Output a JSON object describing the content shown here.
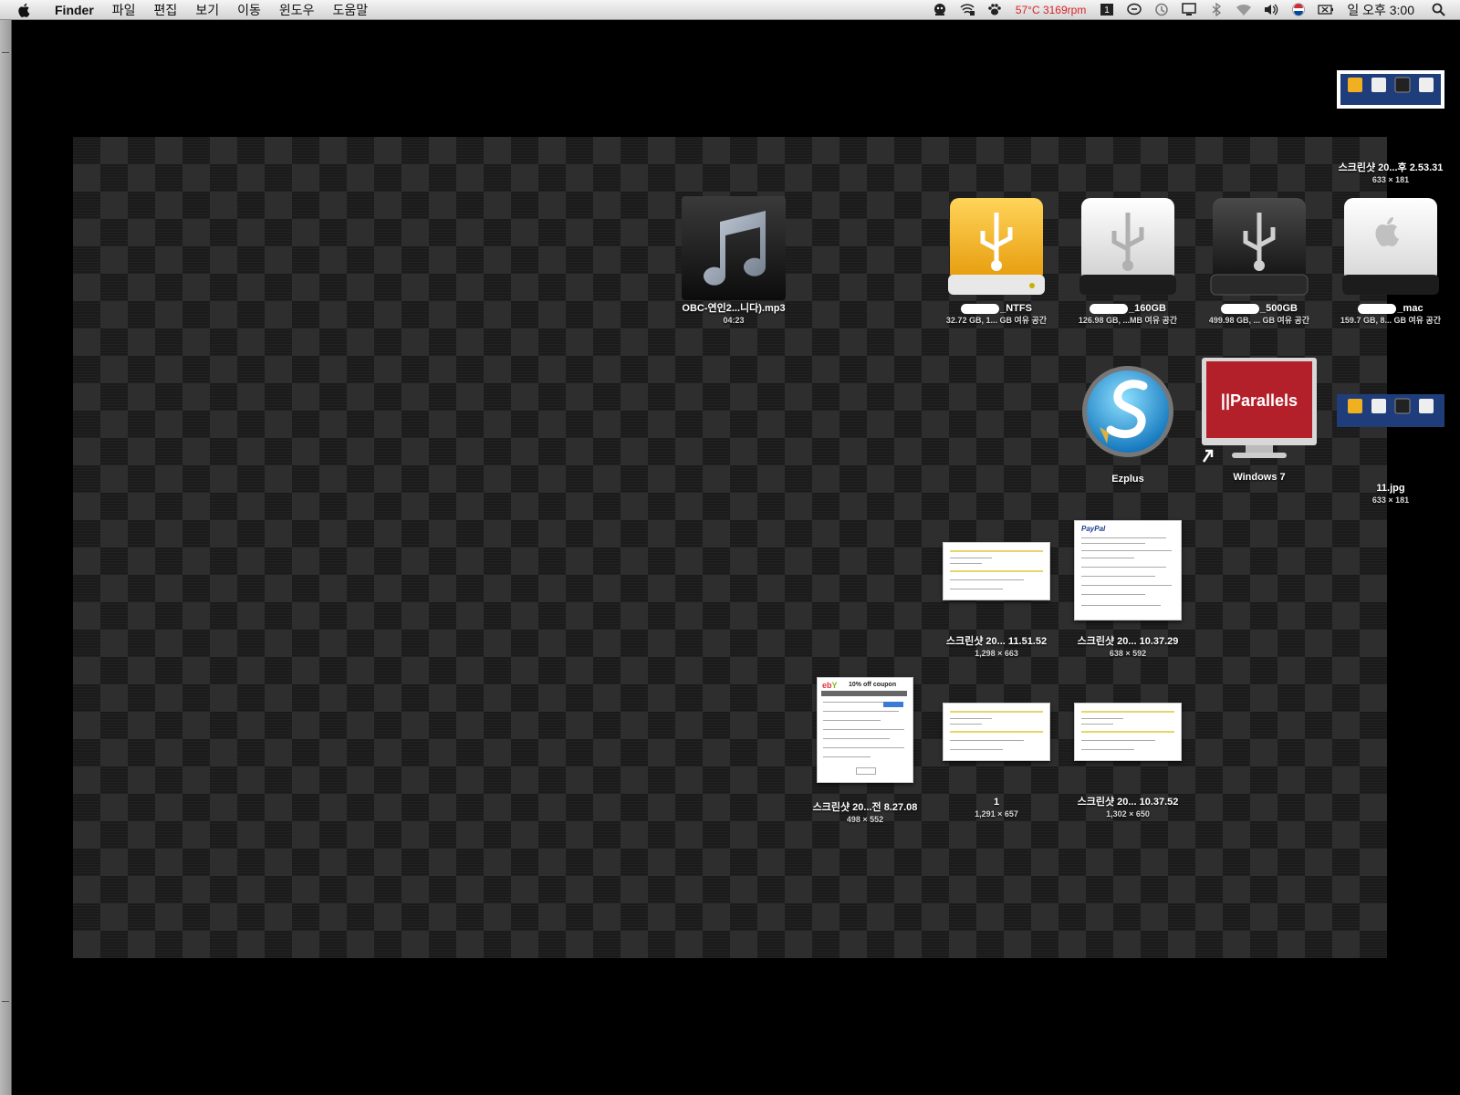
{
  "menubar": {
    "app_name": "Finder",
    "menus": [
      "파일",
      "편집",
      "보기",
      "이동",
      "윈도우",
      "도움말"
    ],
    "status_text": "57°C 3169rpm",
    "clock": "일 오후 3:00",
    "status_icons": [
      "monitor-face-icon",
      "wifi-settings-icon",
      "paw-icon",
      "temperature-icon",
      "spaces-icon",
      "chat-icon",
      "time-machine-icon",
      "display-icon",
      "bluetooth-icon",
      "wifi-icon",
      "volume-icon",
      "input-flag-icon",
      "battery-icon",
      "spotlight-icon"
    ],
    "status_color": "#d8232a"
  },
  "desktop": {
    "items": [
      {
        "id": "mp3",
        "name": "OBC-연인2...니다).mp3",
        "sub": "04:23",
        "icon": "music-note-icon"
      },
      {
        "id": "ntfs",
        "name": "_NTFS",
        "sub": "32.72 GB, 1... GB 여유 공간",
        "icon": "usb-drive-yellow-icon",
        "redacted": true
      },
      {
        "id": "160",
        "name": "_160GB",
        "sub": "126.98 GB, ...MB 여유 공간",
        "icon": "usb-drive-white-icon",
        "redacted": true
      },
      {
        "id": "500",
        "name": "_500GB",
        "sub": "499.98 GB, ... GB 여유 공간",
        "icon": "usb-drive-black-icon",
        "redacted": true
      },
      {
        "id": "mac",
        "name": "_mac",
        "sub": "159.7 GB, 8... GB 여유 공간",
        "icon": "apple-drive-icon",
        "redacted": true
      },
      {
        "id": "shot_top",
        "name": "스크린샷 20...후 2.53.31",
        "sub": "633 × 181",
        "icon": "drives-thumbnail-icon"
      },
      {
        "id": "ezplus",
        "name": "Ezplus",
        "sub": "",
        "icon": "ezplus-app-icon"
      },
      {
        "id": "win7",
        "name": "Windows 7",
        "sub": "",
        "icon": "parallels-monitor-icon"
      },
      {
        "id": "jpg11",
        "name": "11.jpg",
        "sub": "633 × 181",
        "icon": "drives-thumbnail-icon"
      },
      {
        "id": "shot1151",
        "name": "스크린샷 20... 11.51.52",
        "sub": "1,298 × 663",
        "icon": "screenshot-thumbnail-icon"
      },
      {
        "id": "shot1037a",
        "name": "스크린샷 20... 10.37.29",
        "sub": "638 × 592",
        "icon": "paypal-thumbnail-icon"
      },
      {
        "id": "shot827",
        "name": "스크린샷 20...전 8.27.08",
        "sub": "498 × 552",
        "icon": "ebay-coupon-thumbnail-icon"
      },
      {
        "id": "one",
        "name": "1",
        "sub": "1,291 × 657",
        "icon": "screenshot-thumbnail-icon"
      },
      {
        "id": "shot1037b",
        "name": "스크린샷 20... 10.37.52",
        "sub": "1,302 × 650",
        "icon": "screenshot-thumbnail-icon"
      }
    ],
    "parallels_text": "||Parallels",
    "ebay_text": "10% off coupon",
    "paypal_text": "PayPal"
  }
}
